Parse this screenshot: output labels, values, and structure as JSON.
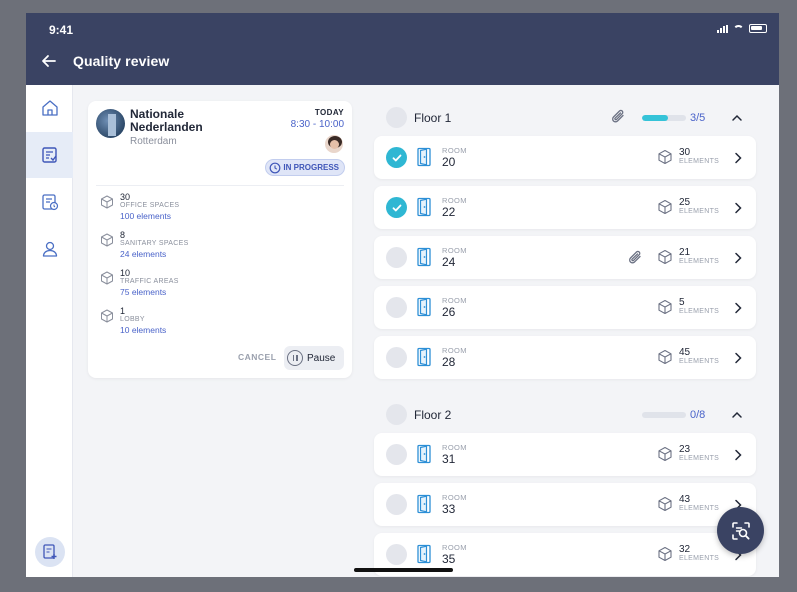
{
  "status_bar": {
    "time": "9:41"
  },
  "header": {
    "title": "Quality review"
  },
  "sidebar": {
    "items": [
      {
        "name": "home",
        "icon": "home-icon",
        "active": false
      },
      {
        "name": "reviews",
        "icon": "checklist-icon",
        "active": true
      },
      {
        "name": "schedule",
        "icon": "schedule-doc-icon",
        "active": false
      },
      {
        "name": "profile",
        "icon": "user-icon",
        "active": false
      }
    ],
    "new_button_icon": "new-document-icon"
  },
  "review_card": {
    "client_name": "Nationale Nederlanden",
    "city": "Rotterdam",
    "day": "TODAY",
    "time": "8:30 - 10:00",
    "status": "IN PROGRESS",
    "spaces": [
      {
        "count": "30",
        "label": "OFFICE SPACES",
        "elements": "100 elements"
      },
      {
        "count": "8",
        "label": "SANITARY SPACES",
        "elements": "24 elements"
      },
      {
        "count": "10",
        "label": "TRAFFIC AREAS",
        "elements": "75 elements"
      },
      {
        "count": "1",
        "label": "LOBBY",
        "elements": "10 elements"
      }
    ],
    "cancel_label": "CANCEL",
    "pause_label": "Pause"
  },
  "floors": [
    {
      "title": "Floor 1",
      "count": "3/5",
      "progress": 0.6,
      "has_attachment": true,
      "rooms": [
        {
          "label": "ROOM",
          "number": "20",
          "elements": "30",
          "elements_label": "ELEMENTS",
          "done": true,
          "attachment": false
        },
        {
          "label": "ROOM",
          "number": "22",
          "elements": "25",
          "elements_label": "ELEMENTS",
          "done": true,
          "attachment": false
        },
        {
          "label": "ROOM",
          "number": "24",
          "elements": "21",
          "elements_label": "ELEMENTS",
          "done": false,
          "attachment": true
        },
        {
          "label": "ROOM",
          "number": "26",
          "elements": "5",
          "elements_label": "ELEMENTS",
          "done": false,
          "attachment": false
        },
        {
          "label": "ROOM",
          "number": "28",
          "elements": "45",
          "elements_label": "ELEMENTS",
          "done": false,
          "attachment": false
        }
      ]
    },
    {
      "title": "Floor 2",
      "count": "0/8",
      "progress": 0,
      "has_attachment": false,
      "rooms": [
        {
          "label": "ROOM",
          "number": "31",
          "elements": "23",
          "elements_label": "ELEMENTS",
          "done": false,
          "attachment": false
        },
        {
          "label": "ROOM",
          "number": "33",
          "elements": "43",
          "elements_label": "ELEMENTS",
          "done": false,
          "attachment": false
        },
        {
          "label": "ROOM",
          "number": "35",
          "elements": "32",
          "elements_label": "ELEMENTS",
          "done": false,
          "attachment": false
        }
      ]
    }
  ],
  "fab": {
    "icon": "scan-search-icon"
  },
  "colors": {
    "header": "#3a4363",
    "accent": "#4a63c9",
    "done": "#2fb7d3",
    "progress": "#35c3d8"
  }
}
